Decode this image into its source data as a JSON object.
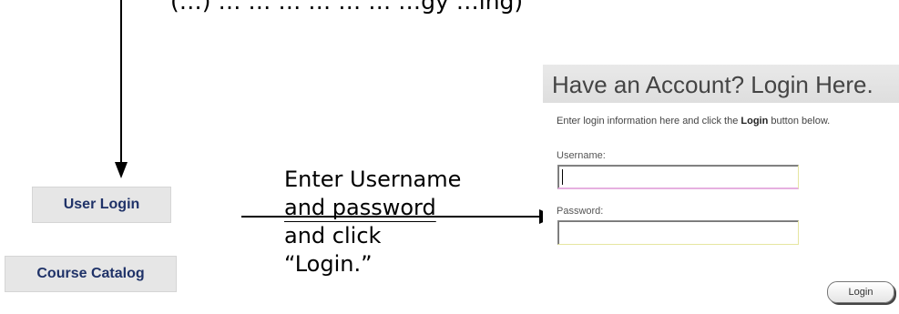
{
  "top_text": "(…) … … … … … … …gy …ing)",
  "sidebar": {
    "user_login": "User Login",
    "course_catalog": "Course Catalog"
  },
  "instruction": {
    "line1": "Enter Username",
    "line2": "and password",
    "line3": "and click",
    "line4": "“Login.”"
  },
  "login_panel": {
    "title": "Have an Account? Login Here.",
    "intro_before": "Enter login information here and click the ",
    "intro_bold": "Login",
    "intro_after": " button below.",
    "username_label": "Username:",
    "username_value": "",
    "password_label": "Password:",
    "password_value": "",
    "login_button": "Login"
  },
  "colors": {
    "side_button_bg": "#e6e6e6",
    "side_button_text": "#1f3268",
    "panel_header_bg": "#e2e2e2"
  }
}
